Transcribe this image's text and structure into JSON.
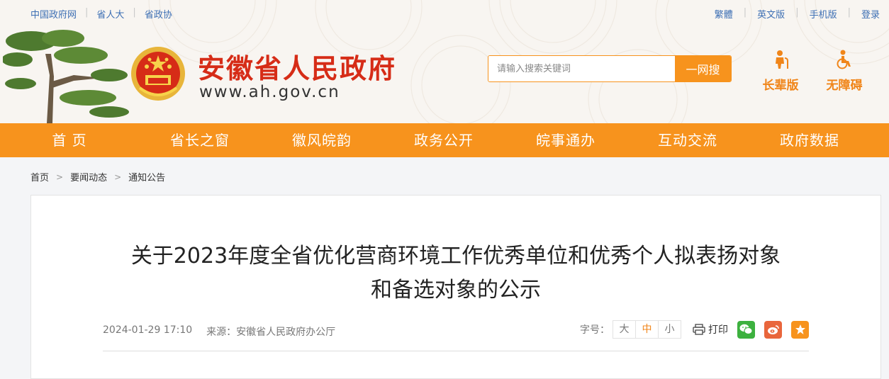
{
  "top_links": [
    "中国政府网",
    "省人大",
    "省政协"
  ],
  "right_links": [
    "繁體",
    "英文版",
    "手机版",
    "登录"
  ],
  "site": {
    "title": "安徽省人民政府",
    "url": "www.ah.gov.cn"
  },
  "search": {
    "placeholder": "请输入搜索关键词",
    "button": "一网搜"
  },
  "modes": {
    "elder": "长辈版",
    "access": "无障碍"
  },
  "nav": [
    "首 页",
    "省长之窗",
    "徽风皖韵",
    "政务公开",
    "皖事通办",
    "互动交流",
    "政府数据"
  ],
  "breadcrumb": [
    "首页",
    "要闻动态",
    "通知公告"
  ],
  "article": {
    "title_line1": "关于2023年度全省优化营商环境工作优秀单位和优秀个人拟表扬对象",
    "title_line2": "和备选对象的公示",
    "date": "2024-01-29 17:10",
    "source": "来源：安徽省人民政府办公厅",
    "font_size_label": "字号：",
    "font_sizes": [
      "大",
      "中",
      "小"
    ],
    "print_label": "打印"
  },
  "colors": {
    "accent": "#f7931d",
    "title_red": "#d62c17",
    "link_blue": "#3d6fb4",
    "wechat": "#3db13f",
    "weibo": "#e9663c",
    "favorite": "#f7931d"
  },
  "icons": [
    "pine-tree-icon",
    "national-emblem-icon",
    "elder-icon",
    "wheelchair-icon",
    "printer-icon",
    "wechat-icon",
    "weibo-icon",
    "star-icon"
  ]
}
